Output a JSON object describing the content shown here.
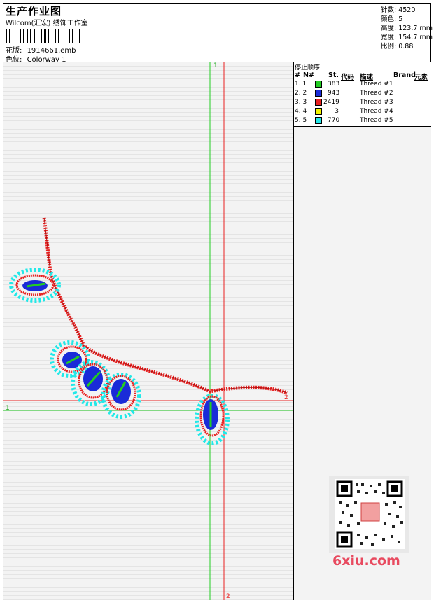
{
  "header": {
    "title": "生产作业图",
    "company": "Wilcom(汇宏) 绣饰工作室",
    "design_label": "花版:",
    "design_value": "1914661.emb",
    "colorway_label": "色位:",
    "colorway_value": "Colorway 1"
  },
  "stats": {
    "stitches": "针数: 4520",
    "colors": "颜色: 5",
    "height": "高度: 123.7 mm",
    "width": "宽度: 154.7 mm",
    "scale": "比例: 0.88"
  },
  "stop_sequence": {
    "title": "停止顺序:",
    "headers": [
      "#",
      "N#",
      "St.",
      "代码",
      "描述",
      "Brand",
      "元素"
    ],
    "rows": [
      {
        "idx": "1. 1",
        "stitches": "383",
        "color": "#22cc22",
        "desc": "Thread #1"
      },
      {
        "idx": "2. 2",
        "stitches": "943",
        "color": "#1a2bd8",
        "desc": "Thread #2"
      },
      {
        "idx": "3. 3",
        "stitches": "2419",
        "color": "#e82020",
        "desc": "Thread #3"
      },
      {
        "idx": "4. 4",
        "stitches": "3",
        "color": "#f5f500",
        "desc": "Thread #4"
      },
      {
        "idx": "5. 5",
        "stitches": "770",
        "color": "#22e8e8",
        "desc": "Thread #5"
      }
    ]
  },
  "axes": {
    "green_top": "1",
    "green_left": "1",
    "red_right": "2",
    "red_bottom": "2"
  },
  "watermark": {
    "site": "6xiu.com"
  }
}
